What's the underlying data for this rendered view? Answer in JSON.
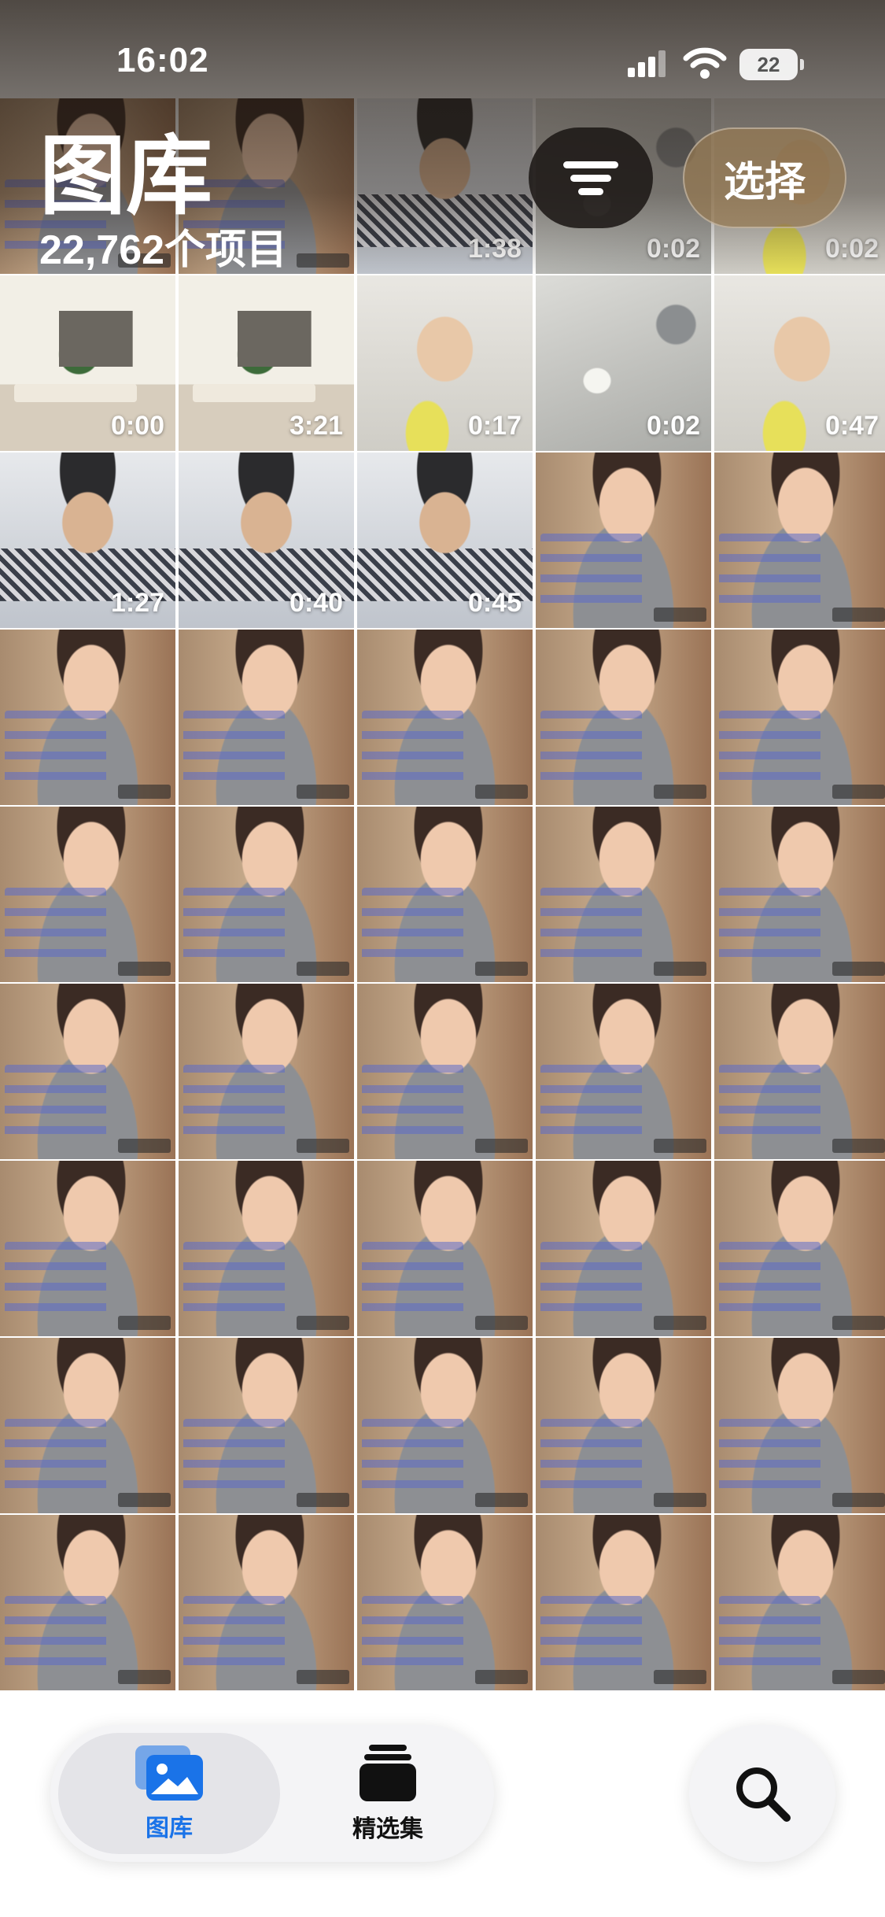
{
  "status_bar": {
    "time": "16:02",
    "battery": "22"
  },
  "header": {
    "title": "图库",
    "item_count": "22,762个项目",
    "select_label": "选择"
  },
  "grid": {
    "tiles": [
      {
        "duration": "",
        "scene": "live"
      },
      {
        "duration": "",
        "scene": "live"
      },
      {
        "duration": "1:38",
        "scene": "desk"
      },
      {
        "duration": "0:02",
        "scene": "sink"
      },
      {
        "duration": "0:02",
        "scene": "bath"
      },
      {
        "duration": "0:00",
        "scene": "room"
      },
      {
        "duration": "3:21",
        "scene": "room"
      },
      {
        "duration": "0:17",
        "scene": "bath"
      },
      {
        "duration": "0:02",
        "scene": "sink"
      },
      {
        "duration": "0:47",
        "scene": "bath"
      },
      {
        "duration": "1:27",
        "scene": "desk"
      },
      {
        "duration": "0:40",
        "scene": "desk"
      },
      {
        "duration": "0:45",
        "scene": "desk"
      },
      {
        "duration": "",
        "scene": "live"
      },
      {
        "duration": "",
        "scene": "live"
      },
      {
        "duration": "",
        "scene": "live"
      },
      {
        "duration": "",
        "scene": "live"
      },
      {
        "duration": "",
        "scene": "live"
      },
      {
        "duration": "",
        "scene": "live"
      },
      {
        "duration": "",
        "scene": "live"
      },
      {
        "duration": "",
        "scene": "live"
      },
      {
        "duration": "",
        "scene": "live"
      },
      {
        "duration": "",
        "scene": "live"
      },
      {
        "duration": "",
        "scene": "live"
      },
      {
        "duration": "",
        "scene": "live"
      },
      {
        "duration": "",
        "scene": "live"
      },
      {
        "duration": "",
        "scene": "live"
      },
      {
        "duration": "",
        "scene": "live"
      },
      {
        "duration": "",
        "scene": "live"
      },
      {
        "duration": "",
        "scene": "live"
      },
      {
        "duration": "",
        "scene": "live"
      },
      {
        "duration": "",
        "scene": "live"
      },
      {
        "duration": "",
        "scene": "live"
      },
      {
        "duration": "",
        "scene": "live"
      },
      {
        "duration": "",
        "scene": "live"
      },
      {
        "duration": "",
        "scene": "live"
      },
      {
        "duration": "",
        "scene": "live"
      },
      {
        "duration": "",
        "scene": "live"
      },
      {
        "duration": "",
        "scene": "live"
      },
      {
        "duration": "",
        "scene": "live"
      },
      {
        "duration": "",
        "scene": "live"
      },
      {
        "duration": "",
        "scene": "live"
      },
      {
        "duration": "",
        "scene": "live"
      },
      {
        "duration": "",
        "scene": "live"
      },
      {
        "duration": "",
        "scene": "live"
      }
    ]
  },
  "tab_bar": {
    "tabs": [
      {
        "label": "图库",
        "icon": "photo-library-icon",
        "active": true
      },
      {
        "label": "精选集",
        "icon": "collections-stack-icon",
        "active": false
      }
    ],
    "search_icon": "search-icon",
    "accent_color": "#1a73e8"
  }
}
